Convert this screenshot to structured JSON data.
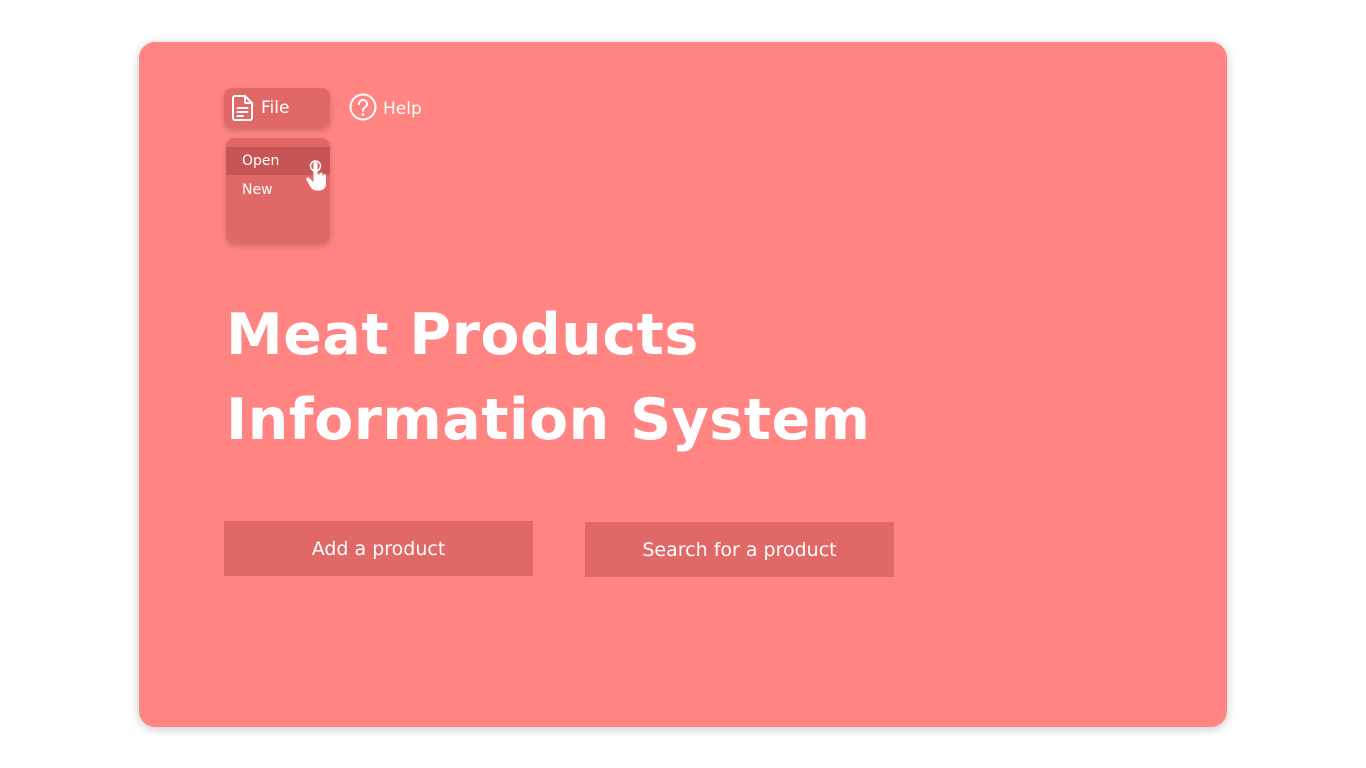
{
  "menu": {
    "file_label": "File",
    "help_label": "Help",
    "file_icon": "document-icon",
    "help_icon": "question-circle-icon"
  },
  "file_dropdown": {
    "items": [
      {
        "label": "Open",
        "active": true
      },
      {
        "label": "New",
        "active": false
      }
    ]
  },
  "main": {
    "title_line1": "Meat Products",
    "title_line2": "Information System"
  },
  "actions": {
    "add_label": "Add a product",
    "search_label": "Search for a product"
  },
  "colors": {
    "background": "#ffffff",
    "card": "#ff8482",
    "button": "#e06968",
    "menu_item_hover": "#c85556",
    "text": "#ffffff"
  }
}
